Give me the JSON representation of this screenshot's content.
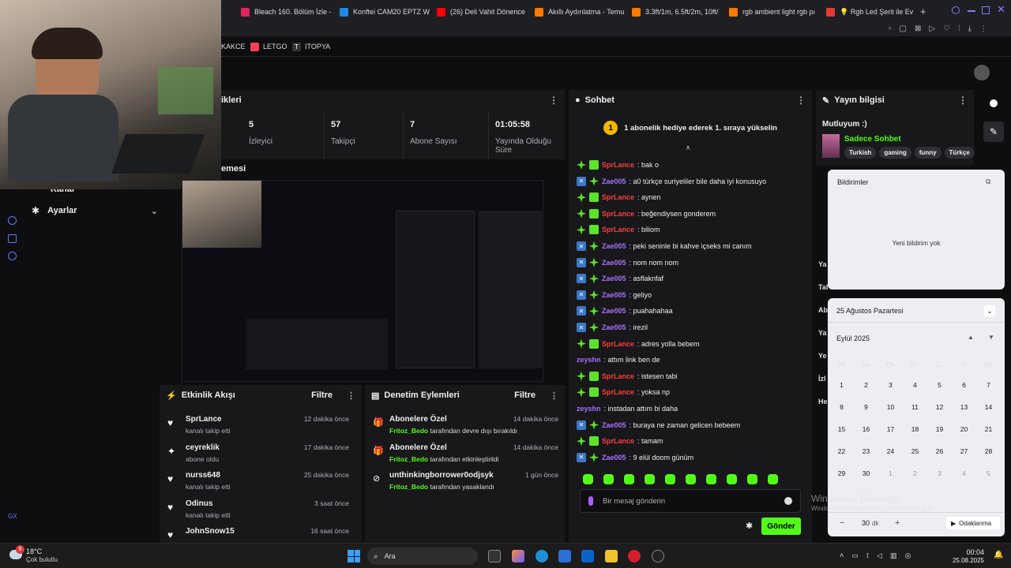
{
  "browser": {
    "tabs": [
      {
        "label": "Bleach 160. Bölüm İzle -",
        "color": "#e0245e"
      },
      {
        "label": "Konftei CAM20 EPTZ W",
        "color": "#1e88e5"
      },
      {
        "label": "(26) Deli Vahit Dönence",
        "color": "#ff0000"
      },
      {
        "label": "Akıllı Aydınlatma - Temu",
        "color": "#ff7a00"
      },
      {
        "label": "3.3ft/1m, 6.5ft/2m, 10ft/",
        "color": "#ff7a00"
      },
      {
        "label": "rgb ambient light rgb pı",
        "color": "#ff7a00"
      },
      {
        "label": "💡 Rgb Led Şerit ile Evi",
        "color": "#e53935"
      }
    ],
    "new_tab": "+",
    "bookmarks": [
      "KAKCE",
      "LETGO",
      "ITOPYA"
    ]
  },
  "stats": {
    "panel_title": "ikleri",
    "items": [
      {
        "value": "5",
        "label": "İzleyici"
      },
      {
        "value": "57",
        "label": "Takipçi"
      },
      {
        "value": "7",
        "label": "Abone Sayısı"
      },
      {
        "value": "01:05:58",
        "label": "Yayında Olduğu Süre"
      }
    ]
  },
  "preview_label": "emesi",
  "sidebar": {
    "kanal": "Kanal",
    "settings": "Ayarlar",
    "footer": "GX"
  },
  "activity": {
    "title": "Etkinlik Akışı",
    "filter": "Filtre",
    "items": [
      {
        "name": "SprLance",
        "sub": "kanalı takip etti",
        "time": "12 dakika önce",
        "icon": "♥"
      },
      {
        "name": "ceyreklik",
        "sub": "abone oldu",
        "time": "17 dakika önce",
        "icon": "✦"
      },
      {
        "name": "nurss648",
        "sub": "kanalı takip etti",
        "time": "25 dakika önce",
        "icon": "♥"
      },
      {
        "name": "Odinus",
        "sub": "kanalı takip etti",
        "time": "3 saat önce",
        "icon": "♥"
      },
      {
        "name": "JohnSnow15",
        "sub": "",
        "time": "16 saat önce",
        "icon": "♥"
      }
    ]
  },
  "moderation": {
    "title": "Denetim Eylemleri",
    "filter": "Filtre",
    "items": [
      {
        "name": "Abonelere Özel",
        "actor": "Fritoz_Bedo",
        "desc": " tarafından devre dışı bırakıldı",
        "time": "14 dakika önce",
        "icon": "🎁"
      },
      {
        "name": "Abonelere Özel",
        "actor": "Fritoz_Bedo",
        "desc": " tarafından etkinleştirildi",
        "time": "14 dakika önce",
        "icon": "🎁"
      },
      {
        "name": "unthinkingborrower0odjsyk",
        "actor": "Fritoz_Bedo",
        "desc": " tarafından yasaklandı",
        "time": "1 gün önce",
        "icon": "⊘"
      }
    ]
  },
  "chat": {
    "title": "Sohbet",
    "banner_rank": "1",
    "banner": "1 abonelik hediye ederek 1. sıraya yükselin",
    "messages": [
      {
        "user": "SprLance",
        "text": ": bak o",
        "color": "#ff3d3d",
        "badge": "bd3"
      },
      {
        "user": "Zae005",
        "text": ": a0 türkçe suriyeliler bile daha iyi konusuyo",
        "color": "#a970ff",
        "badge": "bd2"
      },
      {
        "user": "SprLance",
        "text": ": aynen",
        "color": "#ff3d3d",
        "badge": "bd3"
      },
      {
        "user": "SprLance",
        "text": ": beğendiysen gonderem",
        "color": "#ff3d3d",
        "badge": "bd3"
      },
      {
        "user": "SprLance",
        "text": ": biliom",
        "color": "#ff3d3d",
        "badge": "bd3"
      },
      {
        "user": "Zae005",
        "text": ": peki seninle bi kahve içseks mi canım",
        "color": "#a970ff",
        "badge": "bd2"
      },
      {
        "user": "Zae005",
        "text": ": nom nom nom",
        "color": "#a970ff",
        "badge": "bd2"
      },
      {
        "user": "Zae005",
        "text": ": asflaknfaf",
        "color": "#a970ff",
        "badge": "bd2"
      },
      {
        "user": "Zae005",
        "text": ": geliyo",
        "color": "#a970ff",
        "badge": "bd2"
      },
      {
        "user": "Zae005",
        "text": ": puahahahaa",
        "color": "#a970ff",
        "badge": "bd2"
      },
      {
        "user": "Zae005",
        "text": ": irezil",
        "color": "#a970ff",
        "badge": "bd2"
      },
      {
        "user": "SprLance",
        "text": ": adres yolla bebem",
        "color": "#ff3d3d",
        "badge": "bd3"
      },
      {
        "user": "zeyshn",
        "text": ": attım link ben de",
        "color": "#a970ff",
        "badge": "none"
      },
      {
        "user": "SprLance",
        "text": ": istesen tabi",
        "color": "#ff3d3d",
        "badge": "bd3"
      },
      {
        "user": "SprLance",
        "text": ": yoksa np",
        "color": "#ff3d3d",
        "badge": "bd3"
      },
      {
        "user": "zeyshn",
        "text": ": instadan attım bi daha",
        "color": "#a970ff",
        "badge": "none"
      },
      {
        "user": "Zae005",
        "text": ": buraya ne zaman gelicen bebeem",
        "color": "#a970ff",
        "badge": "bd2"
      },
      {
        "user": "SprLance",
        "text": ": tamam",
        "color": "#ff3d3d",
        "badge": "bd3"
      },
      {
        "user": "Zae005",
        "text": ": 9 elül doom günüm",
        "color": "#a970ff",
        "badge": "bd2"
      }
    ],
    "placeholder": "Bir mesaj gönderin",
    "send": "Gönder"
  },
  "stream_info": {
    "title": "Yayın bilgisi",
    "stream_title": "Mutluyum :)",
    "category": "Sadece Sohbet",
    "tags": [
      "Turkish",
      "gaming",
      "funny",
      "Türkçe"
    ]
  },
  "notifications": {
    "title": "Bildirimler",
    "empty": "Yeni bildirim yok"
  },
  "calendar": {
    "date_header": "25 Ağustos Pazartesi",
    "month": "Eylül 2025",
    "weekdays": [
      "Pt",
      "Sa",
      "Ça",
      "Pe",
      "Cu",
      "Ct",
      "Pa"
    ],
    "weeks": [
      [
        "1",
        "2",
        "3",
        "4",
        "5",
        "6",
        "7"
      ],
      [
        "8",
        "9",
        "10",
        "11",
        "12",
        "13",
        "14"
      ],
      [
        "15",
        "16",
        "17",
        "18",
        "19",
        "20",
        "21"
      ],
      [
        "22",
        "23",
        "24",
        "25",
        "26",
        "27",
        "28"
      ],
      [
        "29",
        "30",
        "1",
        "2",
        "3",
        "4",
        "5"
      ]
    ],
    "focus_minutes": "30",
    "focus_unit": "dk",
    "focus_label": "Odaklanma"
  },
  "hidden_labels": [
    "Ya",
    "Tal",
    "Ab",
    "Ya",
    "Ye",
    "İzl",
    "He"
  ],
  "watermark": {
    "line1": "Windows'u Etkinleştir",
    "line2": "Windows'u etkinleştirmek için Ayarlar'a gidin."
  },
  "taskbar": {
    "weather_temp": "18°C",
    "weather_desc": "Çok bulutlu",
    "weather_badge": "9",
    "search": "Ara",
    "time": "00:04",
    "date": "25.08.2025"
  }
}
